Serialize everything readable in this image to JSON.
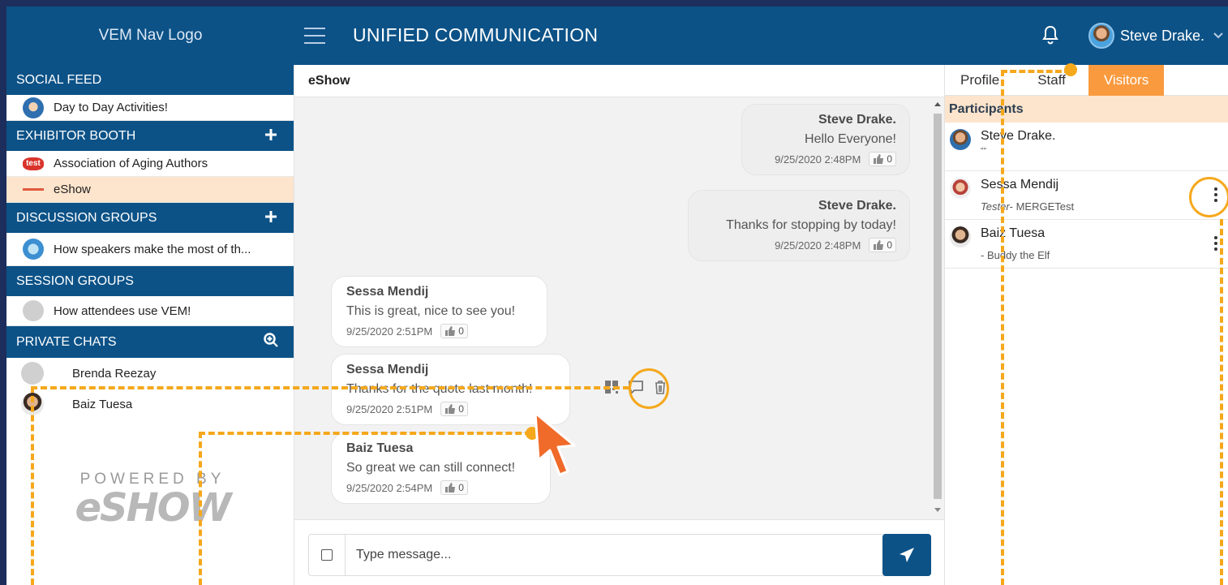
{
  "header": {
    "logo": "VEM Nav Logo",
    "title": "UNIFIED COMMUNICATION",
    "user_name": "Steve Drake."
  },
  "sidebar": {
    "social_feed": {
      "heading": "SOCIAL FEED",
      "items": [
        {
          "label": "Day to Day Activities!"
        }
      ]
    },
    "exhibitor_booth": {
      "heading": "EXHIBITOR BOOTH",
      "items": [
        {
          "label": "Association of Aging Authors",
          "avatar_text": "test"
        },
        {
          "label": "eShow",
          "active": true
        }
      ]
    },
    "discussion_groups": {
      "heading": "DISCUSSION GROUPS",
      "items": [
        {
          "label": "How speakers make the most of th..."
        }
      ]
    },
    "session_groups": {
      "heading": "SESSION GROUPS",
      "items": [
        {
          "label": "How attendees use VEM!"
        }
      ]
    },
    "private_chats": {
      "heading": "PRIVATE CHATS",
      "items": [
        {
          "label": "Brenda Reezay"
        },
        {
          "label": "Baiz Tuesa"
        }
      ]
    },
    "powered_by": {
      "label": "POWERED BY",
      "brand": "eSHOW"
    }
  },
  "chat": {
    "title": "eShow",
    "messages": [
      {
        "author": "Steve Drake.",
        "text": "Hello Everyone!",
        "time": "9/25/2020 2:48PM",
        "likes": "0",
        "mine": true
      },
      {
        "author": "Steve Drake.",
        "text": "Thanks for stopping by today!",
        "time": "9/25/2020 2:48PM",
        "likes": "0",
        "mine": true
      },
      {
        "author": "Sessa Mendij",
        "text": "This is great, nice to see you!",
        "time": "9/25/2020 2:51PM",
        "likes": "0",
        "mine": false
      },
      {
        "author": "Sessa Mendij",
        "text": "Thanks for the quote last month!",
        "time": "9/25/2020 2:51PM",
        "likes": "0",
        "mine": false
      },
      {
        "author": "Baiz Tuesa",
        "text": "So great we can still connect!",
        "time": "9/25/2020 2:54PM",
        "likes": "0",
        "mine": false
      }
    ],
    "composer": {
      "placeholder": "Type message..."
    }
  },
  "right_panel": {
    "tabs": [
      {
        "label": "Profile"
      },
      {
        "label": "Staff"
      },
      {
        "label": "Visitors",
        "active": true
      }
    ],
    "participants_heading": "Participants",
    "participants": [
      {
        "name": "Steve Drake.",
        "subtitle": "\"\""
      },
      {
        "name": "Sessa Mendij",
        "role": "Tester",
        "subtitle": "- MERGETest"
      },
      {
        "name": "Baiz Tuesa",
        "subtitle": "- Buddy the Elf"
      }
    ]
  },
  "colors": {
    "brand_blue": "#0c5287",
    "accent_orange": "#f99a3f",
    "highlight": "#f5a81c",
    "active_bg": "#fde4cc"
  }
}
